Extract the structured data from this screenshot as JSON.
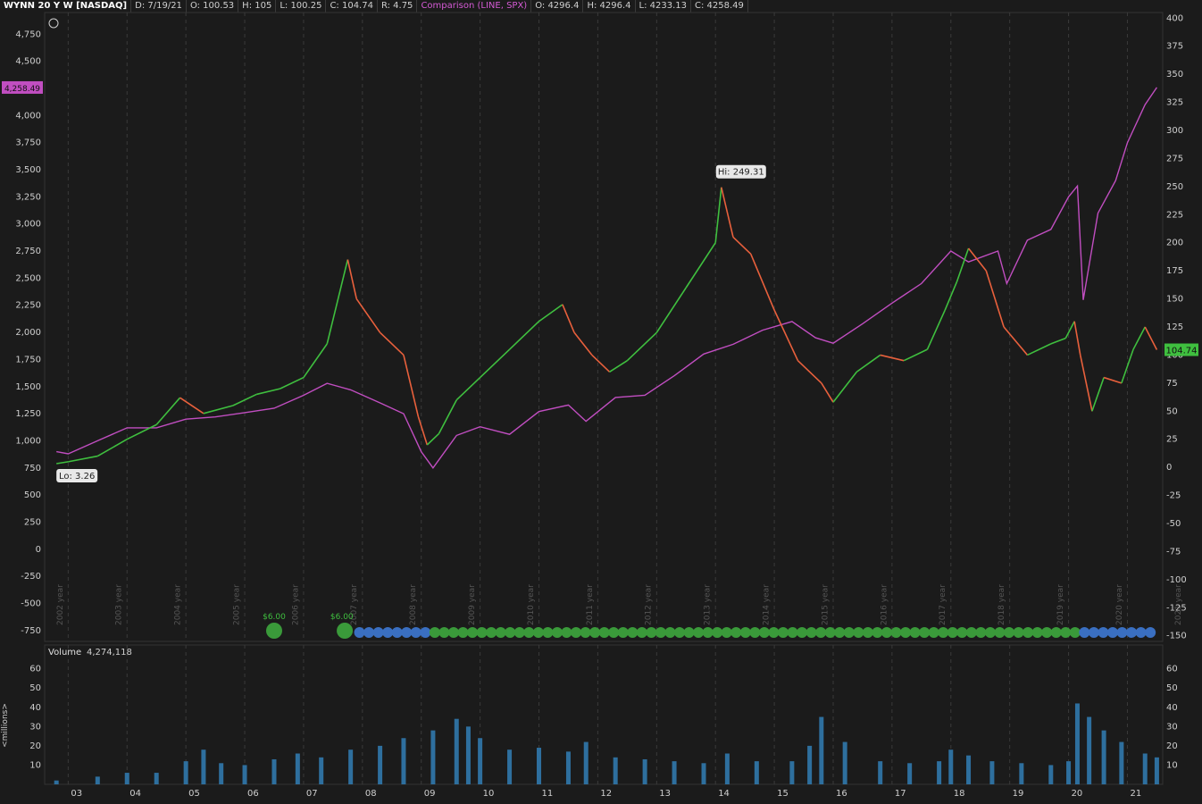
{
  "header": {
    "symbol": "WYNN 20 Y W [NASDAQ]",
    "date": "D: 7/19/21",
    "open": "O: 100.53",
    "high": "H: 105",
    "low": "L: 100.25",
    "close": "C: 104.74",
    "range": "R: 4.75",
    "comparison_title": "Comparison (LINE, SPX)",
    "cmp_open": "O: 4296.4",
    "cmp_high": "H: 4296.4",
    "cmp_low": "L: 4233.13",
    "cmp_close": "C: 4258.49"
  },
  "volume_panel": {
    "title": "Volume",
    "value": "4,274,118",
    "unit_label": "<millions>"
  },
  "colors": {
    "background": "#1b1b1b",
    "up": "#3fbf3f",
    "down": "#e8603c",
    "comparison": "#c14ec1",
    "volume": "#2e6f9e",
    "grid": "#3a3a3a"
  },
  "chart_data": [
    {
      "type": "line",
      "title": "",
      "x_ticks": [
        "03",
        "04",
        "05",
        "06",
        "07",
        "08",
        "09",
        "10",
        "11",
        "12",
        "13",
        "14",
        "15",
        "16",
        "17",
        "18",
        "19",
        "20",
        "21"
      ],
      "y_left_ticks": [
        "4,750",
        "4,500",
        "4,250",
        "4,000",
        "3,750",
        "3,500",
        "3,250",
        "3,000",
        "2,750",
        "2,500",
        "2,250",
        "2,000",
        "1,750",
        "1,500",
        "1,250",
        "1,000",
        "750",
        "500",
        "250",
        "0",
        "-250",
        "-500",
        "-750"
      ],
      "y_left_range": [
        -850,
        4950
      ],
      "y_right_ticks": [
        "400",
        "375",
        "350",
        "325",
        "300",
        "275",
        "250",
        "225",
        "200",
        "175",
        "150",
        "125",
        "100",
        "75",
        "50",
        "25",
        "0",
        "-25",
        "-50",
        "-75",
        "-100",
        "-125",
        "-150"
      ],
      "y_right_range": [
        -155,
        405
      ],
      "year_markers": [
        "2002 year",
        "2003 year",
        "2004 year",
        "2005 year",
        "2006 year",
        "2007 year",
        "2008 year",
        "2009 year",
        "2010 year",
        "2011 year",
        "2012 year",
        "2013 year",
        "2014 year",
        "2015 year",
        "2016 year",
        "2017 year",
        "2018 year",
        "2019 year",
        "2020 year",
        "2021 year"
      ],
      "annotations": {
        "high_label": "Hi: 249.31",
        "low_label": "Lo: 3.26",
        "last_price": "104.74",
        "comparison_last": "4,258.49"
      },
      "dividend_labels": [
        "$6.00",
        "$6.00"
      ],
      "series": [
        {
          "name": "WYNN",
          "axis": "right",
          "x": [
            2002.8,
            2003.0,
            2003.5,
            2004.0,
            2004.5,
            2004.9,
            2005.3,
            2005.8,
            2006.2,
            2006.6,
            2007.0,
            2007.4,
            2007.75,
            2007.9,
            2008.3,
            2008.7,
            2008.95,
            2009.1,
            2009.3,
            2009.6,
            2010.0,
            2010.5,
            2011.0,
            2011.4,
            2011.6,
            2011.9,
            2012.2,
            2012.5,
            2013.0,
            2013.5,
            2014.0,
            2014.1,
            2014.3,
            2014.6,
            2015.0,
            2015.4,
            2015.8,
            2016.0,
            2016.4,
            2016.8,
            2017.2,
            2017.6,
            2017.9,
            2018.1,
            2018.3,
            2018.6,
            2018.9,
            2019.3,
            2019.7,
            2019.95,
            2020.1,
            2020.2,
            2020.4,
            2020.6,
            2020.9,
            2021.1,
            2021.3,
            2021.5
          ],
          "y": [
            3.3,
            5,
            10,
            25,
            38,
            62,
            48,
            55,
            65,
            70,
            80,
            110,
            185,
            150,
            120,
            100,
            45,
            20,
            30,
            60,
            80,
            105,
            130,
            145,
            120,
            100,
            85,
            95,
            120,
            160,
            200,
            249.3,
            205,
            190,
            140,
            95,
            75,
            58,
            85,
            100,
            95,
            105,
            140,
            165,
            195,
            175,
            125,
            100,
            110,
            115,
            130,
            100,
            50,
            80,
            75,
            105,
            125,
            104.7
          ]
        },
        {
          "name": "SPX",
          "axis": "left",
          "x": [
            2002.8,
            2003.0,
            2003.5,
            2004.0,
            2004.5,
            2005.0,
            2005.5,
            2006.0,
            2006.5,
            2007.0,
            2007.4,
            2007.8,
            2008.3,
            2008.7,
            2009.0,
            2009.2,
            2009.6,
            2010.0,
            2010.5,
            2011.0,
            2011.5,
            2011.8,
            2012.3,
            2012.8,
            2013.3,
            2013.8,
            2014.3,
            2014.8,
            2015.3,
            2015.7,
            2016.0,
            2016.5,
            2017.0,
            2017.5,
            2018.0,
            2018.3,
            2018.8,
            2018.95,
            2019.3,
            2019.7,
            2020.0,
            2020.15,
            2020.25,
            2020.5,
            2020.8,
            2021.0,
            2021.3,
            2021.5
          ],
          "y": [
            900,
            880,
            1000,
            1120,
            1120,
            1200,
            1220,
            1260,
            1300,
            1420,
            1530,
            1470,
            1350,
            1250,
            900,
            750,
            1050,
            1130,
            1060,
            1270,
            1330,
            1180,
            1400,
            1420,
            1600,
            1800,
            1890,
            2020,
            2100,
            1950,
            1900,
            2080,
            2270,
            2450,
            2750,
            2650,
            2750,
            2450,
            2850,
            2950,
            3250,
            3350,
            2300,
            3100,
            3400,
            3750,
            4100,
            4258.5
          ]
        }
      ]
    },
    {
      "type": "bar",
      "title": "Volume",
      "ylabel": "<millions>",
      "y_ticks": [
        "60",
        "50",
        "40",
        "30",
        "20",
        "10"
      ],
      "ylim": [
        0,
        64
      ],
      "x": [
        2002.8,
        2003.5,
        2004.0,
        2004.5,
        2005.0,
        2005.3,
        2005.6,
        2006.0,
        2006.5,
        2006.9,
        2007.3,
        2007.8,
        2008.3,
        2008.7,
        2009.2,
        2009.6,
        2009.8,
        2010.0,
        2010.5,
        2011.0,
        2011.5,
        2011.8,
        2012.3,
        2012.8,
        2013.3,
        2013.8,
        2014.2,
        2014.7,
        2015.3,
        2015.6,
        2015.8,
        2016.2,
        2016.8,
        2017.3,
        2017.8,
        2018.0,
        2018.3,
        2018.7,
        2019.2,
        2019.7,
        2020.0,
        2020.15,
        2020.35,
        2020.6,
        2020.9,
        2021.3,
        2021.5
      ],
      "values": [
        2,
        4,
        6,
        6,
        12,
        18,
        11,
        10,
        13,
        16,
        14,
        18,
        20,
        24,
        28,
        34,
        30,
        24,
        18,
        19,
        17,
        22,
        14,
        13,
        12,
        11,
        16,
        12,
        12,
        20,
        35,
        22,
        12,
        11,
        12,
        18,
        15,
        12,
        11,
        10,
        12,
        42,
        35,
        28,
        22,
        16,
        14
      ]
    }
  ]
}
